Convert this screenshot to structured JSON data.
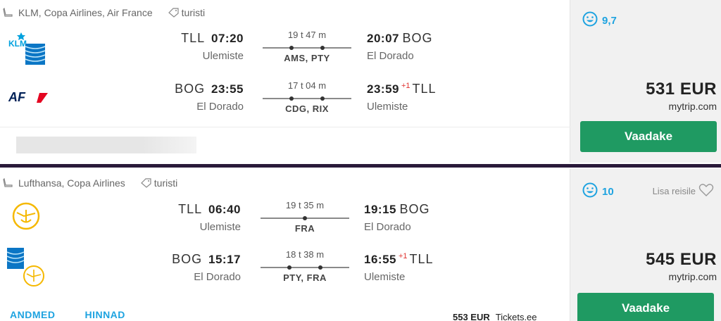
{
  "results": [
    {
      "airlines": "KLM, Copa Airlines, Air France",
      "cabin": "turisti",
      "logos": [
        "klm-logo",
        "airfrance-logo"
      ],
      "logo_text": [
        "KLM",
        "AF"
      ],
      "outbound": {
        "dep_airport": "TLL",
        "dep_time": "07:20",
        "dep_station": "Ulemiste",
        "duration": "19 t 47 m",
        "stops": "AMS, PTY",
        "stop_count": 2,
        "arr_time": "20:07",
        "arr_airport": "BOG",
        "arr_station": "El Dorado",
        "plus_day": ""
      },
      "inbound": {
        "dep_airport": "BOG",
        "dep_time": "23:55",
        "dep_station": "El Dorado",
        "duration": "17 t 04 m",
        "stops": "CDG, RIX",
        "stop_count": 2,
        "arr_time": "23:59",
        "arr_airport": "TLL",
        "arr_station": "Ulemiste",
        "plus_day": "+1"
      },
      "rating": "9,7",
      "price": "531 EUR",
      "provider": "mytrip.com",
      "button": "Vaadake"
    },
    {
      "airlines": "Lufthansa, Copa Airlines",
      "cabin": "turisti",
      "logos": [
        "lufthansa-logo",
        "copa-lufthansa-logo"
      ],
      "outbound": {
        "dep_airport": "TLL",
        "dep_time": "06:40",
        "dep_station": "Ulemiste",
        "duration": "19 t 35 m",
        "stops": "FRA",
        "stop_count": 1,
        "arr_time": "19:15",
        "arr_airport": "BOG",
        "arr_station": "El Dorado",
        "plus_day": ""
      },
      "inbound": {
        "dep_airport": "BOG",
        "dep_time": "15:17",
        "dep_station": "El Dorado",
        "duration": "18 t 38 m",
        "stops": "PTY, FRA",
        "stop_count": 2,
        "arr_time": "16:55",
        "arr_airport": "TLL",
        "arr_station": "Ulemiste",
        "plus_day": "+1"
      },
      "rating": "10",
      "lisa_reisile": "Lisa reisile",
      "price": "545 EUR",
      "provider": "mytrip.com",
      "button": "Vaadake",
      "tabs": [
        "ANDMED",
        "HINNAD"
      ],
      "alt_price": "553 EUR",
      "alt_provider": "Tickets.ee"
    }
  ],
  "colors": {
    "accent": "#1ea3e0",
    "button": "#1f9a62",
    "plus_day": "#e0322f",
    "divider": "#2a1a3a"
  }
}
